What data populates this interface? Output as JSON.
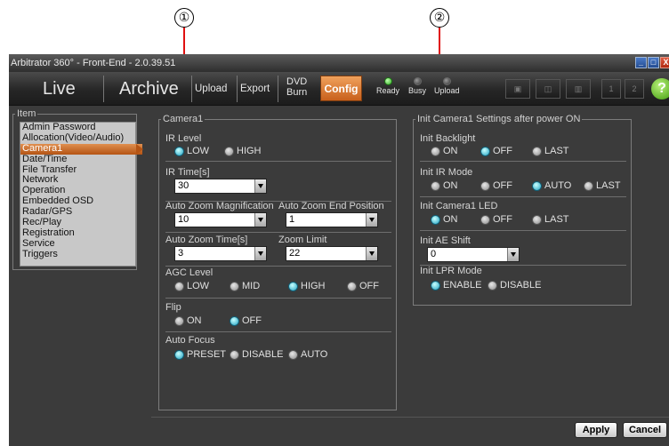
{
  "callouts": [
    "①",
    "②"
  ],
  "window": {
    "title": "Arbitrator 360° - Front-End - 2.0.39.51",
    "controls": {
      "minimize": "_",
      "maximize": "□",
      "close": "X"
    }
  },
  "toolbar": {
    "live": "Live",
    "archive": "Archive",
    "upload": "Upload",
    "export": "Export",
    "dvd_line1": "DVD",
    "dvd_line2": "Burn",
    "config": "Config",
    "status": {
      "ready": "Ready",
      "busy": "Busy",
      "upload": "Upload"
    },
    "help": "?",
    "icons": [
      "record-icon",
      "camera-icon",
      "layout-icon",
      "page-1-icon",
      "page-2-icon"
    ],
    "page_labels": [
      "1",
      "2"
    ]
  },
  "item_panel": {
    "legend": "Item",
    "items": [
      "Admin Password",
      "Allocation(Video/Audio)",
      "Camera1",
      "Date/Time",
      "File Transfer",
      "Network",
      "Operation",
      "Embedded OSD",
      "Radar/GPS",
      "Rec/Play",
      "Registration",
      "Service",
      "Triggers"
    ],
    "selected": "Camera1"
  },
  "camera_panel": {
    "legend": "Camera1",
    "ir_level": {
      "label": "IR Level",
      "options": [
        "LOW",
        "HIGH"
      ],
      "selected": "LOW"
    },
    "ir_time": {
      "label": "IR Time[s]",
      "value": "30"
    },
    "azm": {
      "label": "Auto Zoom Magnification",
      "value": "10"
    },
    "azep": {
      "label": "Auto Zoom End Position",
      "value": "1"
    },
    "azt": {
      "label": "Auto Zoom Time[s]",
      "value": "3"
    },
    "zl": {
      "label": "Zoom Limit",
      "value": "22"
    },
    "agc": {
      "label": "AGC Level",
      "options": [
        "LOW",
        "MID",
        "HIGH",
        "OFF"
      ],
      "selected": "HIGH"
    },
    "flip": {
      "label": "Flip",
      "options": [
        "ON",
        "OFF"
      ],
      "selected": "OFF"
    },
    "af": {
      "label": "Auto Focus",
      "options": [
        "PRESET",
        "DISABLE",
        "AUTO"
      ],
      "selected": "PRESET"
    }
  },
  "init_panel": {
    "legend": "Init Camera1 Settings after power ON",
    "backlight": {
      "label": "Init Backlight",
      "options": [
        "ON",
        "OFF",
        "LAST"
      ],
      "selected": "OFF"
    },
    "ir_mode": {
      "label": "Init IR Mode",
      "options": [
        "ON",
        "OFF",
        "AUTO",
        "LAST"
      ],
      "selected": "AUTO"
    },
    "led": {
      "label": "Init Camera1 LED",
      "options": [
        "ON",
        "OFF",
        "LAST"
      ],
      "selected": "ON"
    },
    "ae_shift": {
      "label": "Init AE Shift",
      "value": "0"
    },
    "lpr": {
      "label": "Init LPR Mode",
      "options": [
        "ENABLE",
        "DISABLE"
      ],
      "selected": "ENABLE"
    }
  },
  "buttons": {
    "apply": "Apply",
    "cancel": "Cancel"
  },
  "colors": {
    "accent": "#d8752e",
    "selected_radio": "#1ea0c0",
    "window_bg": "#3b3b3b",
    "callout_line": "#e01010"
  }
}
